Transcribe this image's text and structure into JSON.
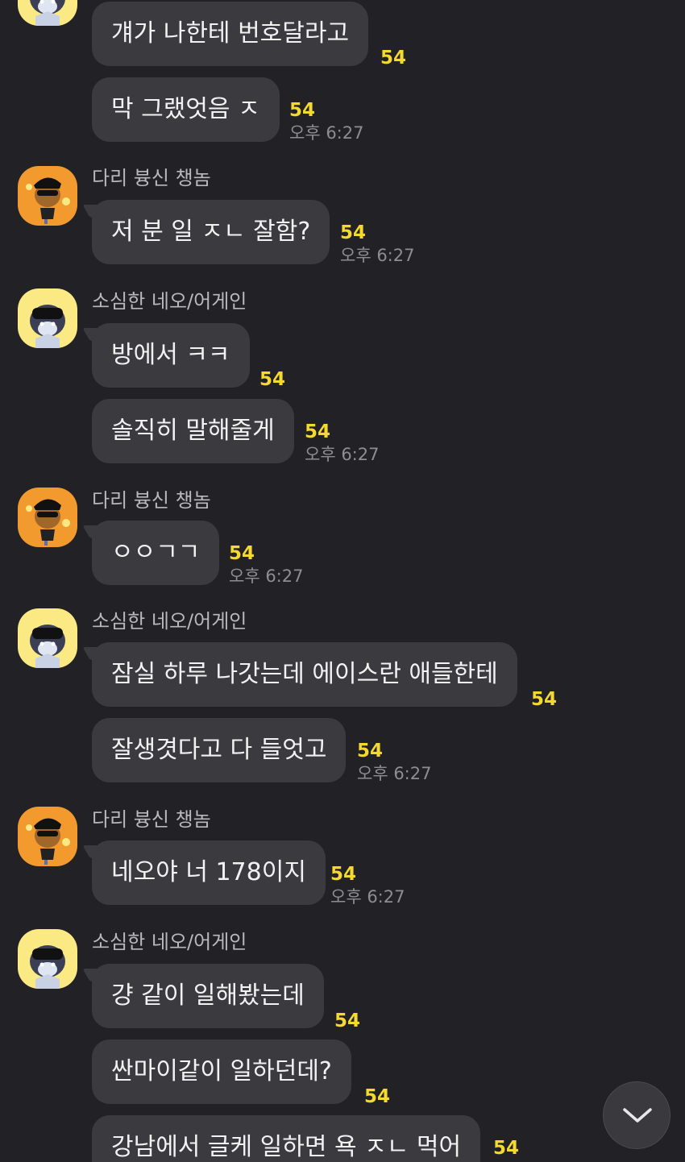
{
  "senders": {
    "neo": "소심한 네오/어게인",
    "frodo": "다리 븅신 챙놈"
  },
  "messages": [
    {
      "text": "걔가 나한테 번호달라고",
      "unread": "54",
      "time": ""
    },
    {
      "text": "막 그랬엇음 ㅈ",
      "unread": "54",
      "time": "오후 6:27"
    },
    {
      "text": "저 분 일 ㅈㄴ 잘함?",
      "unread": "54",
      "time": "오후 6:27"
    },
    {
      "text": "방에서 ㅋㅋ",
      "unread": "54",
      "time": ""
    },
    {
      "text": "솔직히 말해줄게",
      "unread": "54",
      "time": "오후 6:27"
    },
    {
      "text": "ㅇㅇㄱㄱ",
      "unread": "54",
      "time": "오후 6:27"
    },
    {
      "text": "잠실 하루 나갓는데 에이스란 애들한테",
      "unread": "54",
      "time": ""
    },
    {
      "text": "잘생겻다고 다 들엇고",
      "unread": "54",
      "time": "오후 6:27"
    },
    {
      "text": "네오야 너 178이지",
      "unread": "54",
      "time": "오후 6:27"
    },
    {
      "text": "걍 같이 일해봤는데",
      "unread": "54",
      "time": ""
    },
    {
      "text": "싼마이같이 일하던데?",
      "unread": "54",
      "time": ""
    },
    {
      "text": "강남에서 글케 일하면 욕 ㅈㄴ 먹어",
      "unread": "54",
      "time": ""
    }
  ],
  "colors": {
    "background": "#222226",
    "bubble": "#3b3b3f",
    "unread": "#f5d92e",
    "avatar_neo": "#fbe983",
    "avatar_frodo": "#f29a2e"
  },
  "icons": {
    "scroll_down": "chevron-down-icon"
  }
}
